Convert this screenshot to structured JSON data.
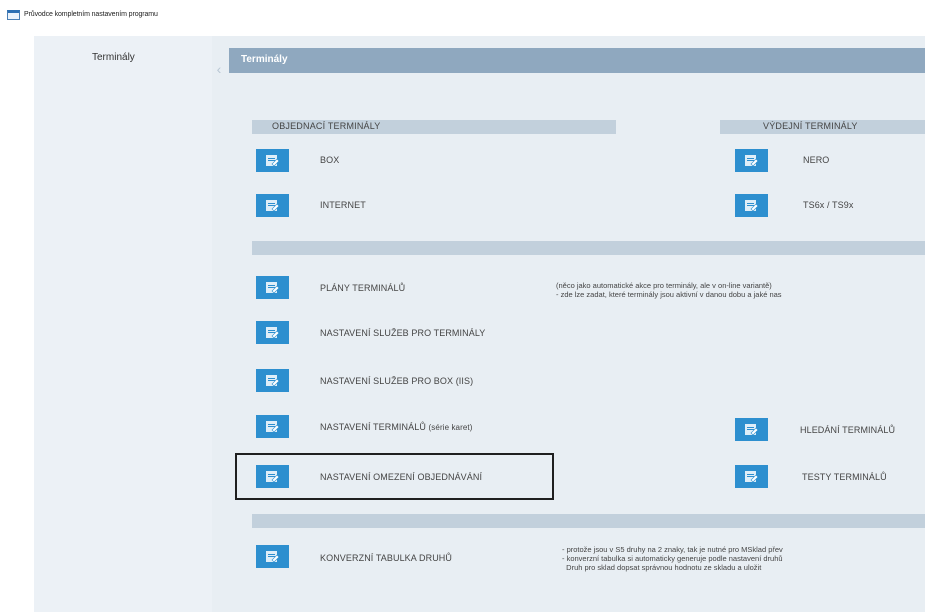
{
  "window": {
    "title": "Průvodce kompletním nastavením programu"
  },
  "sidebar": {
    "items": [
      {
        "label": "Terminály"
      }
    ]
  },
  "main": {
    "header": "Terminály"
  },
  "sections": {
    "ordering": "OBJEDNACÍ TERMINÁLY",
    "dispensing": "VÝDEJNÍ TERMINÁLY"
  },
  "tiles": {
    "box": "BOX",
    "internet": "INTERNET",
    "nero": "NERO",
    "ts": "TS6x / TS9x",
    "plany": "PLÁNY TERMINÁLŮ",
    "sluzby": "NASTAVENÍ SLUŽEB PRO TERMINÁLY",
    "sluzby_box": "NASTAVENÍ SLUŽEB PRO BOX (IIS)",
    "nastaveni_term": "NASTAVENÍ TERMINÁLŮ",
    "nastaveni_term_sub": "(série karet)",
    "hledani": "HLEDÁNÍ TERMINÁLŮ",
    "omezeni": "NASTAVENÍ OMEZENÍ OBJEDNÁVÁNÍ",
    "testy": "TESTY TERMINÁLŮ",
    "konverzni": "KONVERZNÍ TABULKA DRUHŮ"
  },
  "notes": {
    "plany_1": "(něco jako automatické akce pro terminály, ale v on-line variantě)",
    "plany_2": "- zde lze zadat, které terminály jsou aktivní v danou dobu a jaké nas",
    "konv_1": "- protože jsou v S5 druhy na 2 znaky, tak je nutné pro MSklad přev",
    "konv_2": "- konverzní tabulka si automaticky generuje podle nastavení druhů",
    "konv_3": "  Druh pro sklad dopsat správnou hodnotu ze skladu a uložit"
  },
  "colors": {
    "tile": "#2d8fcf",
    "header": "#8fa8bf",
    "section_bar": "#c2d0dc",
    "panel": "#e8eef3",
    "sidebar": "#ecf1f6"
  },
  "icons": {
    "tile_icon": "edit-document-icon",
    "app_icon": "window-icon",
    "collapse": "chevron-left-icon"
  }
}
